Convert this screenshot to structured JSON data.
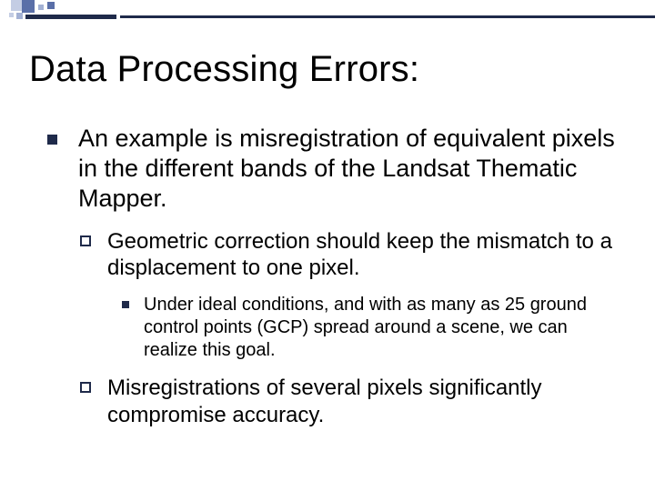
{
  "title": "Data Processing Errors:",
  "bullets": {
    "lvl1": "An example is misregistration of equivalent pixels in the different bands of the Landsat Thematic Mapper.",
    "lvl2a": "Geometric correction should keep the mismatch to a displacement to one pixel.",
    "lvl3": "Under ideal conditions, and with as many as 25 ground control points (GCP) spread around a scene, we can realize this goal.",
    "lvl2b": "Misregistrations of several pixels significantly compromise accuracy."
  }
}
